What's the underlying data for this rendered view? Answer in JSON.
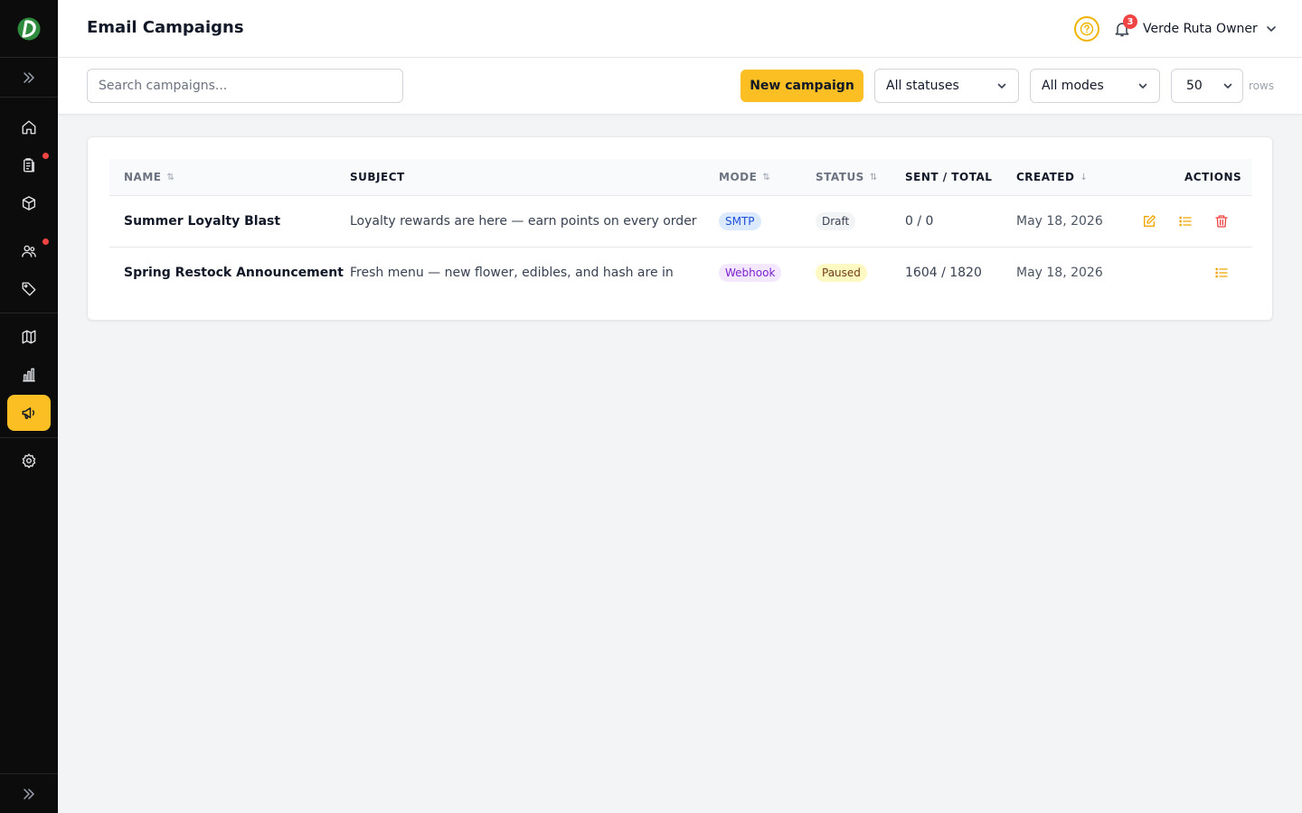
{
  "header": {
    "title": "Email Campaigns",
    "notification_count": "3",
    "user_name": "Verde Ruta Owner"
  },
  "sidebar": {
    "items": [
      {
        "name": "home-icon",
        "active": false,
        "dot": false
      },
      {
        "name": "orders-icon",
        "active": false,
        "dot": true
      },
      {
        "name": "products-icon",
        "active": false,
        "dot": false
      },
      {
        "name": "customers-icon",
        "active": false,
        "dot": true
      },
      {
        "name": "tag-icon",
        "active": false,
        "dot": false
      },
      {
        "name": "map-icon",
        "active": false,
        "dot": false
      },
      {
        "name": "analytics-icon",
        "active": false,
        "dot": false
      },
      {
        "name": "megaphone-icon",
        "active": true,
        "dot": false
      },
      {
        "name": "settings-icon",
        "active": false,
        "dot": false
      }
    ]
  },
  "toolbar": {
    "search_placeholder": "Search campaigns...",
    "new_campaign_label": "New campaign",
    "status_filter": "All statuses",
    "mode_filter": "All modes",
    "rows_value": "50",
    "rows_label": "rows"
  },
  "table": {
    "columns": {
      "name": "NAME",
      "subject": "SUBJECT",
      "mode": "MODE",
      "status": "STATUS",
      "sent_total": "SENT / TOTAL",
      "created": "CREATED",
      "actions": "ACTIONS"
    },
    "rows": [
      {
        "name": "Summer Loyalty Blast",
        "subject": "Loyalty rewards are here — earn points on every order",
        "mode": "SMTP",
        "status": "Draft",
        "sent_total": "0 / 0",
        "created": "May 18, 2026"
      },
      {
        "name": "Spring Restock Announcement",
        "subject": "Fresh menu — new flower, edibles, and hash are in",
        "mode": "Webhook",
        "status": "Paused",
        "sent_total": "1604 / 1820",
        "created": "May 18, 2026"
      }
    ]
  },
  "colors": {
    "accent": "#fbbf24",
    "sidebar_bg": "#0c0c0c",
    "smtp_badge_bg": "#dbeafe",
    "smtp_badge_fg": "#1d4ed8",
    "webhook_badge_bg": "#f3e8ff",
    "webhook_badge_fg": "#7e22ce",
    "draft_badge_bg": "#f3f4f6",
    "paused_badge_bg": "#fef9c3",
    "delete_red": "#ef4444"
  }
}
